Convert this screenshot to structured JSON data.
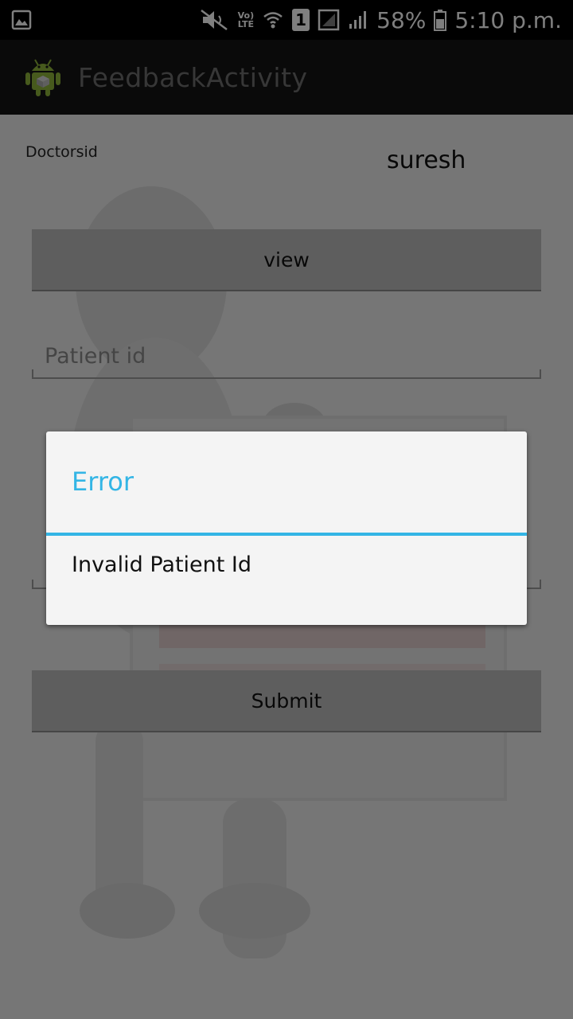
{
  "status_bar": {
    "volte": "Vo)",
    "lte": "LTE",
    "sim_slot": "1",
    "battery_percent": "58%",
    "time": "5:10 p.m."
  },
  "action_bar": {
    "title": "FeedbackActivity"
  },
  "form": {
    "doctor_label": "Doctorsid",
    "doctor_value": "suresh",
    "view_button": "view",
    "patient_id_placeholder": "Patient id",
    "submit_button": "Submit"
  },
  "dialog": {
    "title": "Error",
    "message": "Invalid Patient Id"
  },
  "colors": {
    "accent": "#33b5e5",
    "action_bar": "#141414",
    "status_bar": "#000000"
  }
}
